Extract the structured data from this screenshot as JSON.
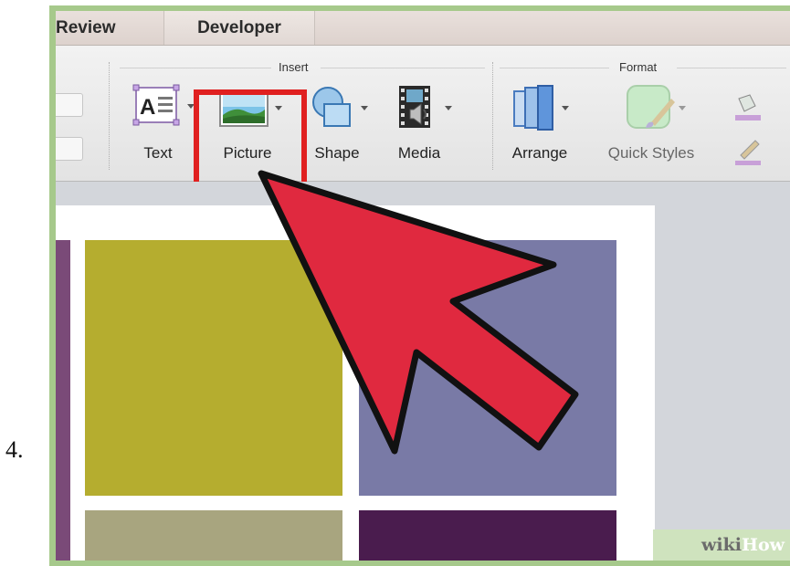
{
  "step": {
    "number": "4."
  },
  "tabs": {
    "review": "Review",
    "developer": "Developer"
  },
  "ribbon": {
    "groups": {
      "insert": "Insert",
      "format": "Format"
    },
    "buttons": {
      "text": "Text",
      "picture": "Picture",
      "shape": "Shape",
      "media": "Media",
      "arrange": "Arrange",
      "quick_styles": "Quick Styles"
    }
  },
  "colors": {
    "highlight": "#e02020",
    "arrow_fill": "#e0293f",
    "slide_olive": "#b5ad2f",
    "slide_slate": "#797aa6",
    "slide_khaki": "#a8a57f",
    "slide_plum": "#4a1c4e",
    "frame_green": "#a6c98b"
  },
  "watermark": {
    "part1": "wiki",
    "part2": "How"
  }
}
